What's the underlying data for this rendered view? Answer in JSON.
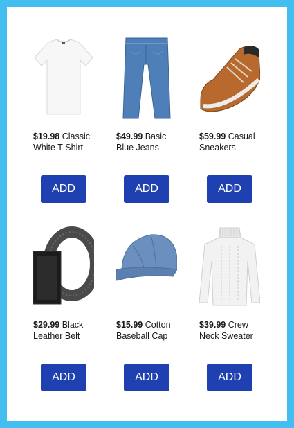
{
  "products": [
    {
      "price": "$19.98",
      "name": "Classic White T-Shirt",
      "image": "white-tshirt-image",
      "button_label": "ADD"
    },
    {
      "price": "$49.99",
      "name": "Basic Blue Jeans",
      "image": "blue-jeans-image",
      "button_label": "ADD"
    },
    {
      "price": "$59.99",
      "name": "Casual Sneakers",
      "image": "casual-sneakers-image",
      "button_label": "ADD"
    },
    {
      "price": "$29.99",
      "name": "Black Leather Belt",
      "image": "black-leather-belt-image",
      "button_label": "ADD"
    },
    {
      "price": "$15.99",
      "name": "Cotton Baseball Cap",
      "image": "baseball-cap-image",
      "button_label": "ADD"
    },
    {
      "price": "$39.99",
      "name": "Crew Neck Sweater",
      "image": "crew-neck-sweater-image",
      "button_label": "ADD"
    }
  ],
  "colors": {
    "background": "#43bef0",
    "card": "#ffffff",
    "button": "#1e40b0",
    "button_text": "#ffffff"
  }
}
